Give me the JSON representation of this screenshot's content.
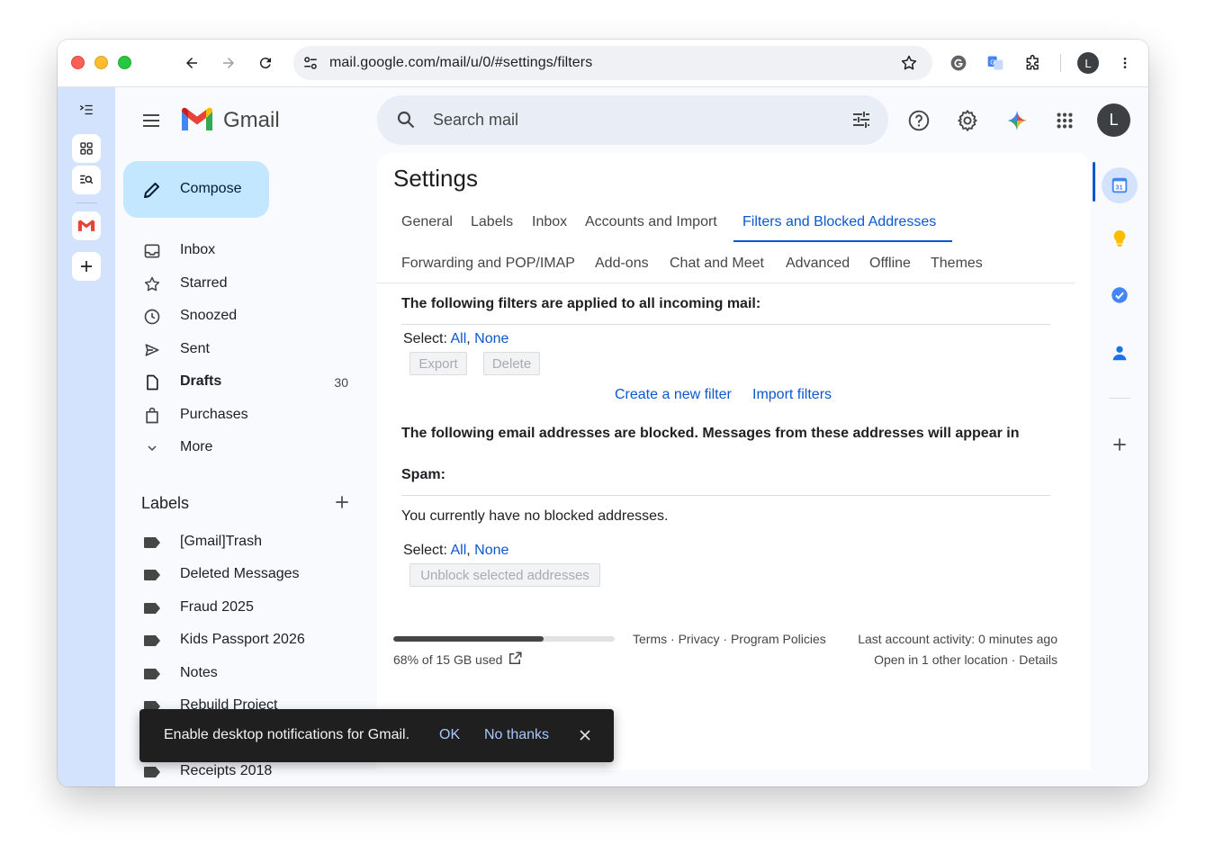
{
  "browser": {
    "url": "mail.google.com/mail/u/0/#settings/filters",
    "profile_initial": "L"
  },
  "app": {
    "name": "Gmail",
    "avatar_initial": "L",
    "search_placeholder": "Search mail"
  },
  "sidebar": {
    "compose_label": "Compose",
    "items": [
      {
        "label": "Inbox",
        "icon": "inbox-icon",
        "count": ""
      },
      {
        "label": "Starred",
        "icon": "star-icon",
        "count": ""
      },
      {
        "label": "Snoozed",
        "icon": "clock-icon",
        "count": ""
      },
      {
        "label": "Sent",
        "icon": "send-icon",
        "count": ""
      },
      {
        "label": "Drafts",
        "icon": "draft-icon",
        "count": "30"
      },
      {
        "label": "Purchases",
        "icon": "shopping-bag-icon",
        "count": ""
      },
      {
        "label": "More",
        "icon": "chevron-down-icon",
        "count": ""
      }
    ],
    "labels_header": "Labels",
    "labels": [
      "[Gmail]Trash",
      "Deleted Messages",
      "Fraud 2025",
      "Kids Passport 2026",
      "Notes",
      "Rebuild Project",
      "Receipts 2018"
    ]
  },
  "settings": {
    "title": "Settings",
    "tabs_row1": [
      "General",
      "Labels",
      "Inbox",
      "Accounts and Import",
      "Filters and Blocked Addresses"
    ],
    "tabs_row2": [
      "Forwarding and POP/IMAP",
      "Add-ons",
      "Chat and Meet",
      "Advanced",
      "Offline",
      "Themes"
    ],
    "active_tab": "Filters and Blocked Addresses",
    "filters": {
      "heading": "The following filters are applied to all incoming mail:",
      "select_label": "Select:",
      "select_all": "All",
      "select_none": "None",
      "export_label": "Export",
      "delete_label": "Delete",
      "create_filter": "Create a new filter",
      "import_filters": "Import filters"
    },
    "blocked": {
      "heading_line1": "The following email addresses are blocked. Messages from these addresses will appear in",
      "heading_line2": "Spam:",
      "empty_text": "You currently have no blocked addresses.",
      "select_label": "Select:",
      "select_all": "All",
      "select_none": "None",
      "unblock_label": "Unblock selected addresses"
    }
  },
  "footer": {
    "storage_text": "68% of 15 GB used",
    "storage_fraction": 0.68,
    "terms": "Terms",
    "privacy": "Privacy",
    "policies": "Program Policies",
    "sep": "·",
    "last_activity": "Last account activity: 0 minutes ago",
    "open_in": "Open in 1 other location",
    "details": "Details"
  },
  "snackbar": {
    "text": "Enable desktop notifications for Gmail.",
    "ok": "OK",
    "no_thanks": "No thanks"
  },
  "colors": {
    "accent": "#0b57d0",
    "compose_bg": "#c2e7ff",
    "rail_bg": "#d3e3fd"
  }
}
